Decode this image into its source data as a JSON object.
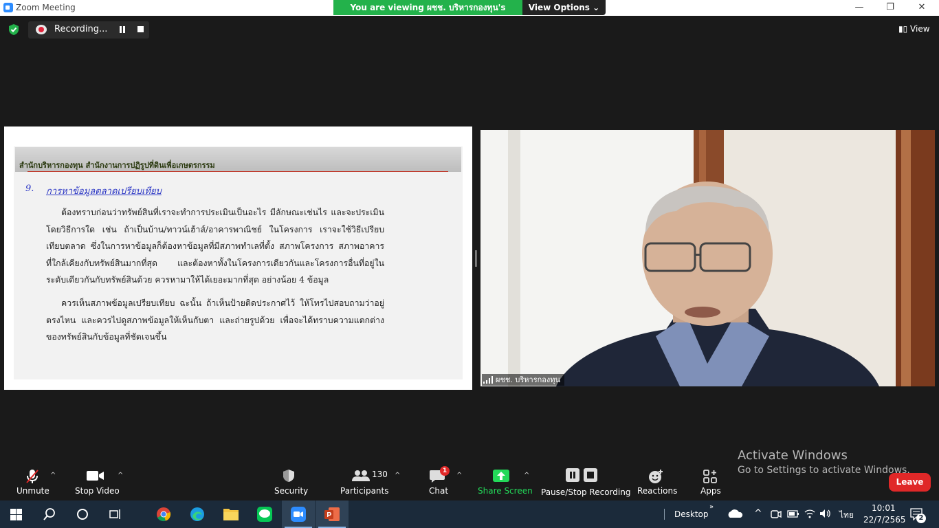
{
  "window": {
    "app_title": "Zoom Meeting",
    "banner": "You are viewing ผชช. บริหารกองทุน's screen",
    "view_options": "View Options",
    "minimize": "—",
    "restore": "❐",
    "close": "✕"
  },
  "top": {
    "recording_label": "Recording...",
    "view_label": "View"
  },
  "slide": {
    "header": "สำนักบริหารกองทุน สำนักงานการปฏิรูปที่ดินเพื่อเกษตรกรรม",
    "section_number": "9.",
    "section_title": "การหาข้อมูลตลาดเปรียบเทียบ",
    "paragraph1": "ต้องทราบก่อนว่าทรัพย์สินที่เราจะทำการประเมินเป็นอะไร มีลักษณะเช่นไร และจะประเมินโดยวิธีการใด เช่น ถ้าเป็นบ้าน/ทาวน์เฮ้าส์/อาคารพาณิชย์ ในโครงการ เราจะใช้วิธีเปรียบเทียบตลาด ซึ่งในการหาข้อมูลก็ต้องหาข้อมูลที่มีสภาพทำเลที่ตั้ง สภาพโครงการ สภาพอาคาร ที่ใกล้เคียงกับทรัพย์สินมากที่สุด และต้องหาทั้งในโครงการเดียวกันและโครงการอื่นที่อยู่ในระดับเดียวกันกับทรัพย์สินด้วย ควรหามาให้ได้เยอะมากที่สุด อย่างน้อย 4 ข้อมูล",
    "paragraph2": "ควรเห็นสภาพข้อมูลเปรียบเทียบ ฉะนั้น ถ้าเห็นป้ายติดประกาศไว้ ให้โทรไปสอบถามว่าอยู่ตรงไหน และควรไปดูสภาพข้อมูลให้เห็นกับตา และถ่ายรูปด้วย เพื่อจะได้ทราบความแตกต่างของทรัพย์สินกับข้อมูลที่ชัดเจนขึ้น"
  },
  "video": {
    "participant_name": "ผชช. บริหารกองทุน"
  },
  "toolbar": {
    "unmute": "Unmute",
    "stop_video": "Stop Video",
    "security": "Security",
    "participants": "Participants",
    "participants_count": "130",
    "chat": "Chat",
    "chat_badge": "1",
    "share_screen": "Share Screen",
    "pause_stop_recording": "Pause/Stop Recording",
    "reactions": "Reactions",
    "apps": "Apps",
    "leave": "Leave"
  },
  "activation": {
    "line1": "Activate Windows",
    "line2": "Go to Settings to activate Windows."
  },
  "taskbar": {
    "desktop_label": "Desktop",
    "lang": "ไทย",
    "time": "10:01",
    "date": "22/7/2565",
    "notif_count": "2"
  },
  "colors": {
    "banner_green": "#23b24b",
    "leave_red": "#e02828",
    "share_green": "#23d959",
    "link_blue": "#2a35c4"
  }
}
